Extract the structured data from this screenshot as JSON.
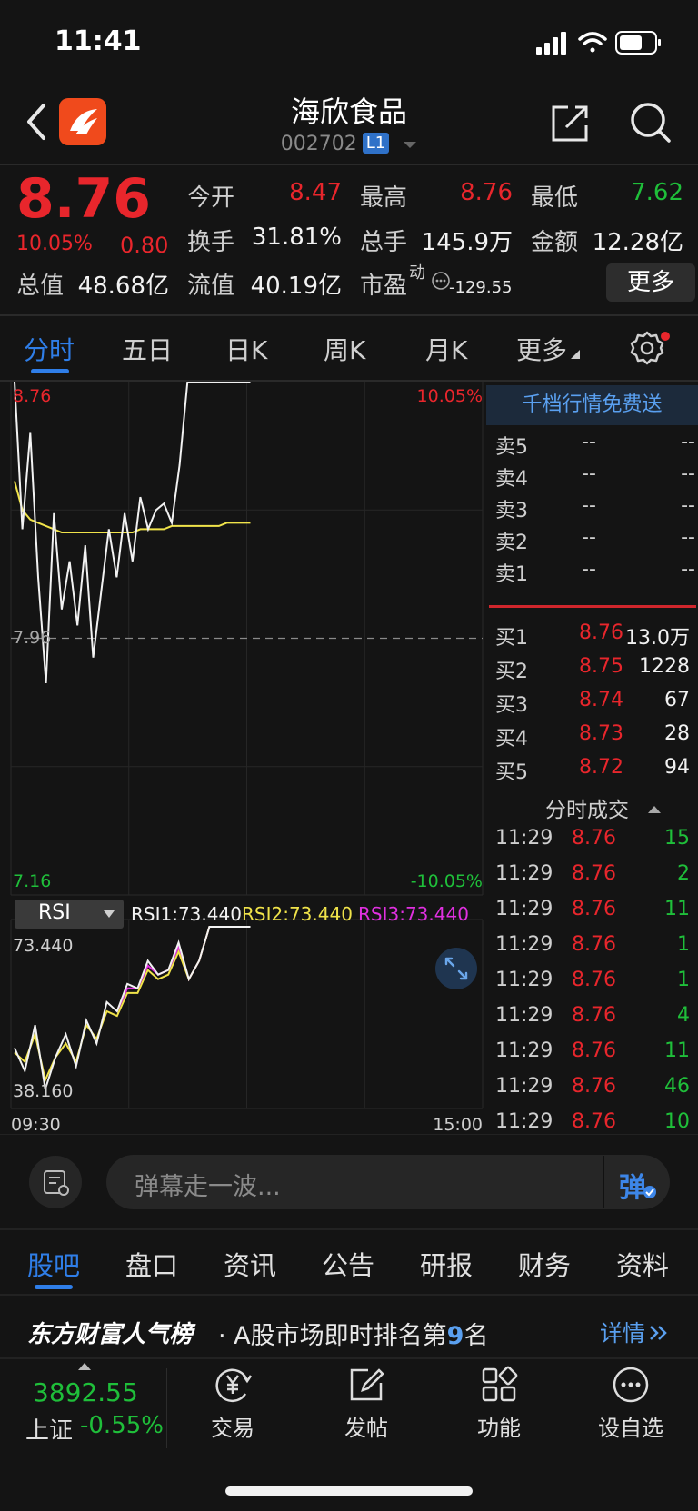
{
  "status_bar": {
    "time": "11:41"
  },
  "header": {
    "title": "海欣食品",
    "code": "002702",
    "level_badge": "L1"
  },
  "quote": {
    "price": "8.76",
    "change_pct": "10.05%",
    "change": "0.80",
    "open_label": "今开",
    "open": "8.47",
    "high_label": "最高",
    "high": "8.76",
    "low_label": "最低",
    "low": "7.62",
    "turnover_label": "换手",
    "turnover": "31.81%",
    "volume_label": "总手",
    "volume": "145.9万",
    "amount_label": "金额",
    "amount": "12.28亿",
    "mktcap_label": "总值",
    "mktcap": "48.68亿",
    "float_label": "流值",
    "float_cap": "40.19亿",
    "pe_label": "市盈",
    "pe_sup": "动",
    "pe": "-129.55",
    "more_label": "更多"
  },
  "tabs": [
    "分时",
    "五日",
    "日K",
    "周K",
    "月K",
    "更多"
  ],
  "chart": {
    "price_top": "8.76",
    "price_mid": "7.96",
    "price_bottom": "7.16",
    "pct_top": "10.05%",
    "pct_bottom": "-10.05%",
    "rsi_select": "RSI",
    "rsi1": "RSI1:73.440",
    "rsi2": "RSI2:73.440",
    "rsi3": "RSI3:73.440",
    "rsi_top": "73.440",
    "rsi_bottom": "38.160",
    "time_start": "09:30",
    "time_end": "15:00"
  },
  "chart_data": {
    "type": "line",
    "x_range": [
      "09:30",
      "15:00"
    ],
    "ylim": [
      7.16,
      8.76
    ],
    "ylim_pct": [
      "-10.05%",
      "10.05%"
    ],
    "prev_close": 7.96,
    "series": [
      {
        "values": [
          8.76,
          8.3,
          8.6,
          8.15,
          7.82,
          8.35,
          8.05,
          8.2,
          8.0,
          8.25,
          7.9,
          8.1,
          8.3,
          8.15,
          8.35,
          8.2,
          8.4,
          8.3,
          8.36,
          8.38,
          8.32,
          8.5,
          8.76,
          8.76,
          8.76,
          8.76,
          8.76,
          8.76,
          8.76,
          8.76,
          8.76
        ]
      },
      {
        "values": [
          8.45,
          8.36,
          8.33,
          8.32,
          8.31,
          8.3,
          8.29,
          8.29,
          8.29,
          8.29,
          8.29,
          8.29,
          8.29,
          8.29,
          8.29,
          8.29,
          8.3,
          8.3,
          8.3,
          8.3,
          8.31,
          8.31,
          8.31,
          8.31,
          8.31,
          8.31,
          8.31,
          8.32,
          8.32,
          8.32,
          8.32
        ]
      }
    ],
    "rsi": {
      "ylim": [
        38.16,
        73.44
      ],
      "series": [
        {
          "name": "RSI1",
          "values": [
            47,
            42,
            52,
            38,
            45,
            50,
            43,
            53,
            48,
            57,
            55,
            61,
            60,
            66,
            63,
            64,
            70,
            62,
            66,
            73.44,
            73.44,
            73.44,
            73.44,
            73.44
          ]
        },
        {
          "name": "RSI2",
          "values": [
            46,
            44,
            50,
            40,
            45,
            48,
            44,
            52,
            49,
            55,
            54,
            59,
            59,
            64,
            62,
            63,
            68,
            62,
            66,
            73.44,
            73.44,
            73.44,
            73.44,
            73.44
          ]
        },
        {
          "name": "RSI3",
          "values": [
            null,
            null,
            null,
            null,
            null,
            null,
            null,
            null,
            null,
            null,
            55,
            60,
            60,
            65,
            63,
            64,
            69,
            62,
            66,
            73.44,
            73.44,
            73.44,
            73.44,
            73.44
          ]
        }
      ]
    }
  },
  "order_book": {
    "banner": "千档行情免费送",
    "asks": [
      {
        "label": "卖5",
        "price": "--",
        "vol": "--"
      },
      {
        "label": "卖4",
        "price": "--",
        "vol": "--"
      },
      {
        "label": "卖3",
        "price": "--",
        "vol": "--"
      },
      {
        "label": "卖2",
        "price": "--",
        "vol": "--"
      },
      {
        "label": "卖1",
        "price": "--",
        "vol": "--"
      }
    ],
    "bids": [
      {
        "label": "买1",
        "price": "8.76",
        "vol": "13.0万"
      },
      {
        "label": "买2",
        "price": "8.75",
        "vol": "1228"
      },
      {
        "label": "买3",
        "price": "8.74",
        "vol": "67"
      },
      {
        "label": "买4",
        "price": "8.73",
        "vol": "28"
      },
      {
        "label": "买5",
        "price": "8.72",
        "vol": "94"
      }
    ],
    "trades_title": "分时成交",
    "trades": [
      {
        "time": "11:29",
        "price": "8.76",
        "vol": "15"
      },
      {
        "time": "11:29",
        "price": "8.76",
        "vol": "2"
      },
      {
        "time": "11:29",
        "price": "8.76",
        "vol": "11"
      },
      {
        "time": "11:29",
        "price": "8.76",
        "vol": "1"
      },
      {
        "time": "11:29",
        "price": "8.76",
        "vol": "1"
      },
      {
        "time": "11:29",
        "price": "8.76",
        "vol": "4"
      },
      {
        "time": "11:29",
        "price": "8.76",
        "vol": "11"
      },
      {
        "time": "11:29",
        "price": "8.76",
        "vol": "46"
      },
      {
        "time": "11:29",
        "price": "8.76",
        "vol": "10"
      }
    ]
  },
  "danmaku": {
    "placeholder": "弹幕走一波...",
    "send_label": "弹"
  },
  "bottom_tabs": [
    "股吧",
    "盘口",
    "资讯",
    "公告",
    "研报",
    "财务",
    "资料"
  ],
  "ranking": {
    "brand": "东方财富人气榜",
    "text_prefix": "· A股市场即时排名第",
    "rank": "9",
    "text_suffix": "名",
    "detail": "详情"
  },
  "index": {
    "value": "3892.55",
    "label": "上证",
    "pct": "-0.55%"
  },
  "nav": [
    {
      "label": "交易",
      "icon": "yuan-exchange-icon"
    },
    {
      "label": "发帖",
      "icon": "edit-icon"
    },
    {
      "label": "功能",
      "icon": "grid-icon"
    },
    {
      "label": "设自选",
      "icon": "more-circle-icon"
    }
  ]
}
